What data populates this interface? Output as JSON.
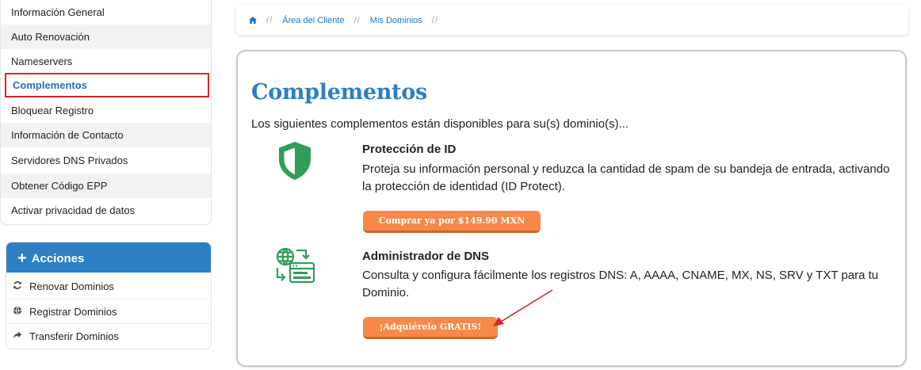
{
  "sidebar": {
    "items": [
      {
        "label": "Información General"
      },
      {
        "label": "Auto Renovación"
      },
      {
        "label": "Nameservers"
      },
      {
        "label": "Complementos"
      },
      {
        "label": "Bloquear Registro"
      },
      {
        "label": "Información de Contacto"
      },
      {
        "label": "Servidores DNS Privados"
      },
      {
        "label": "Obtener Código EPP"
      },
      {
        "label": "Activar privacidad de datos"
      }
    ]
  },
  "actions": {
    "title": "Acciones",
    "items": [
      {
        "label": "Renovar Dominios",
        "icon": "refresh-icon"
      },
      {
        "label": "Registrar Dominios",
        "icon": "globe-icon"
      },
      {
        "label": "Transferir Dominios",
        "icon": "share-arrow-icon"
      }
    ]
  },
  "breadcrumb": {
    "items": [
      "Área del Cliente",
      "Mis Dominios"
    ]
  },
  "main": {
    "title": "Complementos",
    "subtitle": "Los siguientes complementos están disponibles para su(s) dominio(s)...",
    "addons": [
      {
        "name": "Protección de ID",
        "description": "Proteja su información personal y reduzca la cantidad de spam de su bandeja de entrada, activando la protección de identidad (ID Protect).",
        "button": "Comprar ya por $149.90 MXN",
        "icon": "shield-icon"
      },
      {
        "name": "Administrador de DNS",
        "description": "Consulta y configura fácilmente los registros DNS: A, AAAA, CNAME, MX, NS, SRV y TXT para tu Dominio.",
        "button": "¡Adquiérelo GRATIS!",
        "icon": "dns-manager-icon"
      }
    ]
  },
  "colors": {
    "accent": "#2d7fc4",
    "highlight": "#d9262c",
    "button": "#f6894a",
    "icon_green": "#2f9e5b"
  }
}
